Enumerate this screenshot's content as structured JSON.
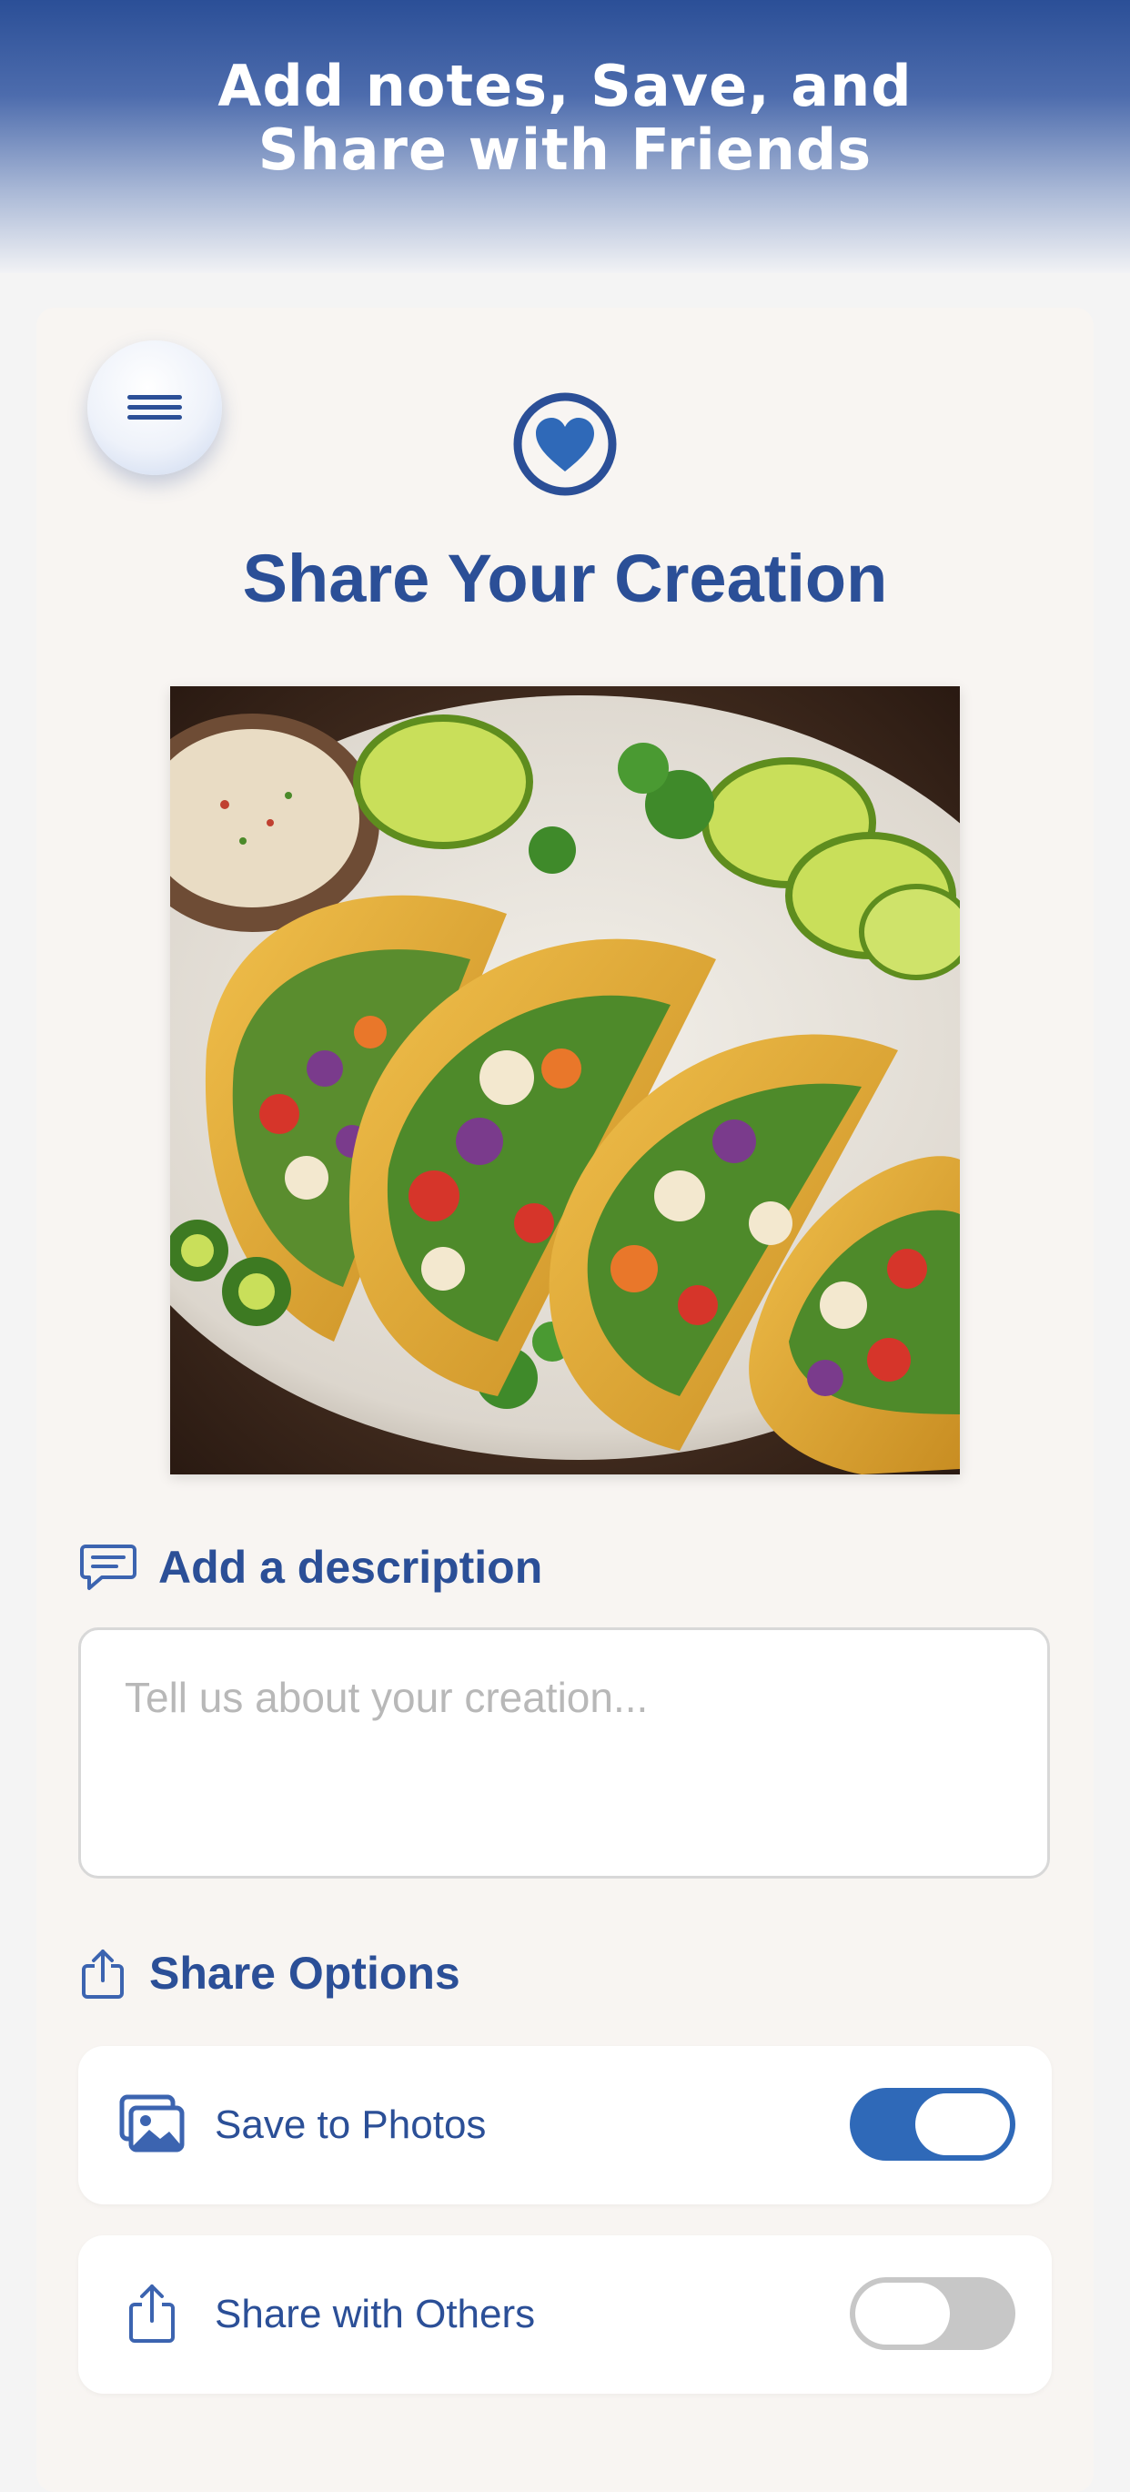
{
  "header": {
    "title": "Add notes, Save, and\nShare with Friends"
  },
  "screen": {
    "title": "Share Your Creation"
  },
  "photo": {
    "subject": "vegetable tacos with lime, cilantro and dipping sauce"
  },
  "description": {
    "heading": "Add a description",
    "placeholder": "Tell us about your creation..."
  },
  "share": {
    "heading": "Share Options",
    "options": [
      {
        "label": "Save to Photos",
        "icon": "photos-icon",
        "enabled": true
      },
      {
        "label": "Share with Others",
        "icon": "share-icon",
        "enabled": false
      }
    ]
  },
  "colors": {
    "accent": "#2b4f97",
    "toggle_on": "#2f69b8",
    "toggle_off": "#c7c7c7",
    "card_bg": "#f8f5f2"
  }
}
